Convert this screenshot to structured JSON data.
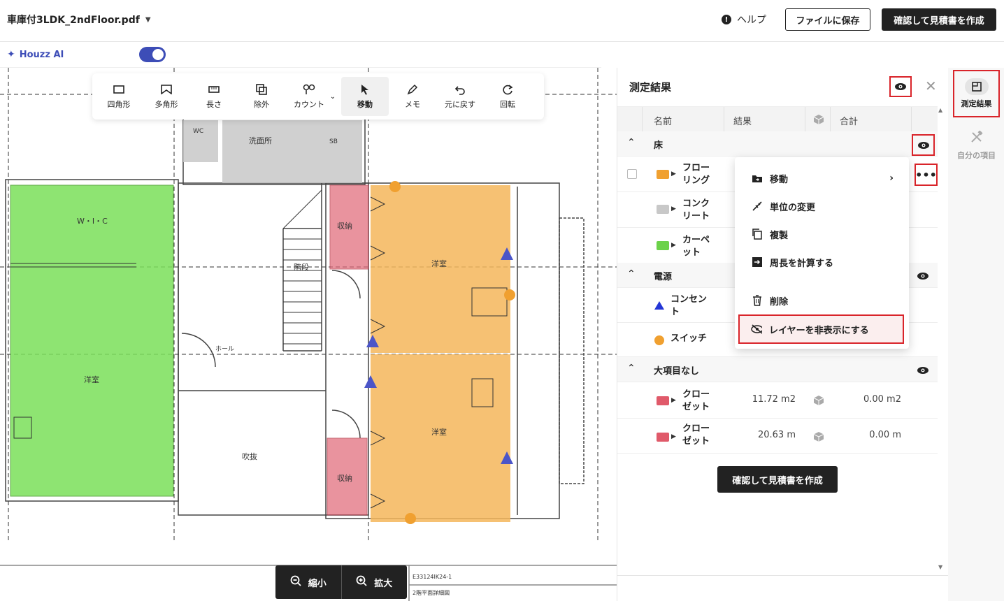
{
  "header": {
    "filename": "車庫付3LDK_2ndFloor.pdf",
    "help_label": "ヘルプ",
    "save_label": "ファイルに保存",
    "confirm_label": "確認して見積書を作成"
  },
  "subbar": {
    "houzz_ai_label": "Houzz AI",
    "toggle_on": true
  },
  "toolbar": {
    "tools": [
      {
        "label": "四角形",
        "icon": "rectangle-icon"
      },
      {
        "label": "多角形",
        "icon": "polygon-icon"
      },
      {
        "label": "長さ",
        "icon": "ruler-icon"
      },
      {
        "label": "除外",
        "icon": "exclude-icon"
      },
      {
        "label": "カウント",
        "icon": "count-icon"
      },
      {
        "label": "移動",
        "icon": "cursor-icon",
        "active": true
      },
      {
        "label": "メモ",
        "icon": "pen-icon"
      },
      {
        "label": "元に戻す",
        "icon": "undo-icon"
      },
      {
        "label": "回転",
        "icon": "rotate-icon"
      }
    ]
  },
  "zoom": {
    "out_label": "縮小",
    "in_label": "拡大"
  },
  "floorplan": {
    "room_labels": [
      "W・I・C",
      "洋室",
      "洗面所",
      "収納",
      "階段",
      "洋室",
      "洋室",
      "吹抜",
      "収納",
      "ホール",
      "WC",
      "SB"
    ],
    "footer_code": "E33124IK24-1",
    "footer_title": "2階平面詳細図",
    "colors": {
      "green": "#7be05a",
      "orange": "#f5b65a",
      "red": "#e06676",
      "gray": "#c8c8c8",
      "triangle": "#4b55c8",
      "circle": "#f0a030"
    }
  },
  "panel": {
    "title": "測定結果",
    "columns": [
      "名前",
      "結果",
      "合計"
    ],
    "groups": [
      {
        "label": "床",
        "items": [
          {
            "name": "フローリング",
            "name_lines": [
              "フロー",
              "リング"
            ],
            "folder_color": "#f0a030"
          },
          {
            "name": "コンクリート",
            "name_lines": [
              "コンク",
              "リート"
            ],
            "folder_color": "#c8c8c8"
          },
          {
            "name": "カーペット",
            "name_lines": [
              "カーペ",
              "ット"
            ],
            "folder_color": "#6cd24a"
          }
        ]
      },
      {
        "label": "電源",
        "items": [
          {
            "name": "コンセント",
            "name_lines": [
              "コンセン",
              "ト"
            ],
            "marker": "triangle"
          },
          {
            "name": "スイッチ",
            "name_lines": [
              "スイッチ"
            ],
            "marker": "circle"
          }
        ]
      },
      {
        "label": "大項目なし",
        "items": [
          {
            "name": "クローゼット",
            "name_lines": [
              "クロー",
              "ゼット"
            ],
            "folder_color": "#e05a6a",
            "result": "11.72 m2",
            "total": "0.00 m2"
          },
          {
            "name": "クローゼット",
            "name_lines": [
              "クロー",
              "ゼット"
            ],
            "folder_color": "#e05a6a",
            "result": "20.63 m",
            "total": "0.00 m"
          }
        ]
      }
    ],
    "confirm_label": "確認して見積書を作成"
  },
  "context_menu": {
    "items": [
      {
        "label": "移動",
        "icon": "folder-move-icon",
        "has_submenu": true
      },
      {
        "label": "単位の変更",
        "icon": "unit-icon"
      },
      {
        "label": "複製",
        "icon": "copy-icon"
      },
      {
        "label": "周長を計算する",
        "icon": "perimeter-icon"
      },
      {
        "label": "削除",
        "icon": "trash-icon"
      },
      {
        "label": "レイヤーを非表示にする",
        "icon": "eye-off-icon"
      }
    ]
  },
  "rail": {
    "items": [
      {
        "label": "測定結果",
        "icon": "measure-results-icon",
        "active": true
      },
      {
        "label": "自分の項目",
        "icon": "my-items-icon"
      }
    ]
  }
}
